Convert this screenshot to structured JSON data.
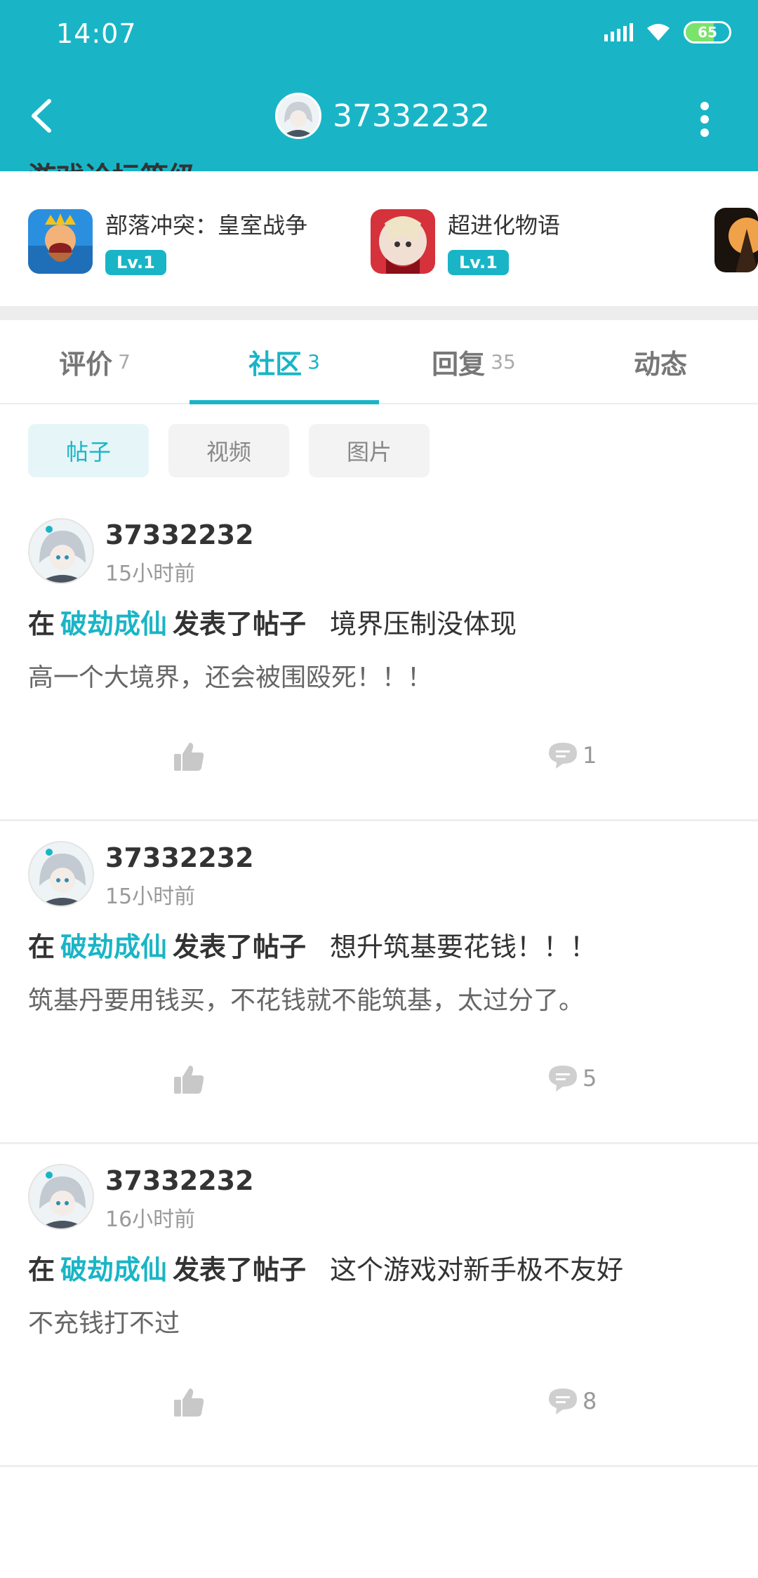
{
  "status": {
    "time": "14:07",
    "battery": "65"
  },
  "header": {
    "title": "37332232"
  },
  "levels": {
    "title": "游戏论坛等级",
    "items": [
      {
        "name": "部落冲突：皇室战争",
        "level": "Lv.1"
      },
      {
        "name": "超进化物语",
        "level": "Lv.1"
      }
    ]
  },
  "tabs": [
    {
      "label": "评价",
      "count": "7"
    },
    {
      "label": "社区",
      "count": "3"
    },
    {
      "label": "回复",
      "count": "35"
    },
    {
      "label": "动态",
      "count": ""
    }
  ],
  "filters": [
    "帖子",
    "视频",
    "图片"
  ],
  "posts": [
    {
      "author": "37332232",
      "time": "15小时前",
      "prefix": "在",
      "game": "破劫成仙",
      "action": "发表了帖子",
      "title": "境界压制没体现",
      "body": "高一个大境界，还会被围殴死！！！",
      "comments": "1"
    },
    {
      "author": "37332232",
      "time": "15小时前",
      "prefix": "在",
      "game": "破劫成仙",
      "action": "发表了帖子",
      "title": "想升筑基要花钱！！！",
      "body": "筑基丹要用钱买，不花钱就不能筑基，太过分了。",
      "comments": "5"
    },
    {
      "author": "37332232",
      "time": "16小时前",
      "prefix": "在",
      "game": "破劫成仙",
      "action": "发表了帖子",
      "title": "这个游戏对新手极不友好",
      "body": "不充钱打不过",
      "comments": "8"
    }
  ],
  "colors": {
    "accent": "#19b5c6"
  }
}
